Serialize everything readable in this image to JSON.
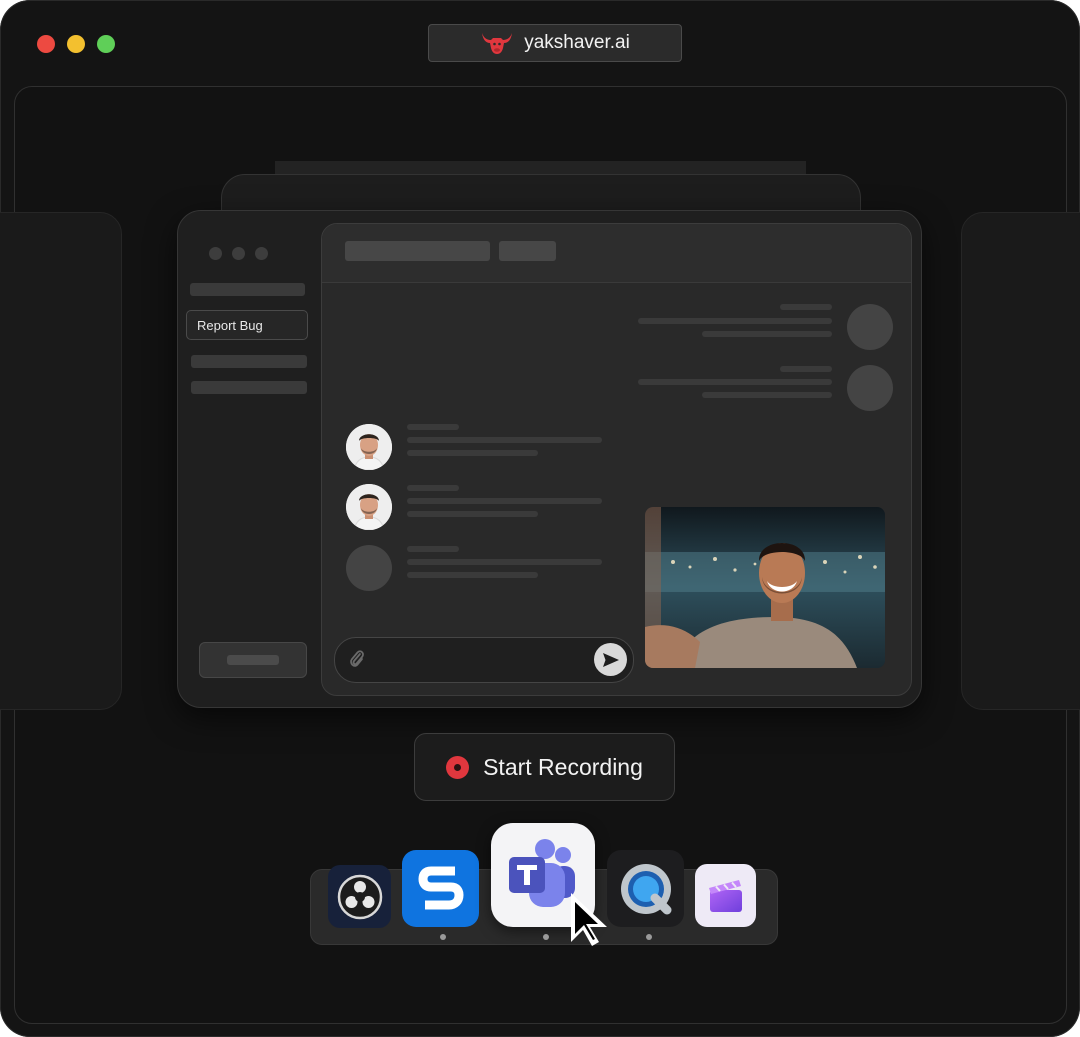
{
  "window": {
    "traffic_lights": [
      "close",
      "minimize",
      "zoom"
    ],
    "colors": {
      "close": "#ed4a41",
      "minimize": "#f3c02f",
      "zoom": "#5fcf58"
    }
  },
  "url_bar": {
    "icon": "bull-logo-icon",
    "text": "yakshaver.ai",
    "icon_color": "#e0373e"
  },
  "app_window": {
    "sidebar": {
      "items": [
        {
          "label": ""
        },
        {
          "label": "Report Bug",
          "selected": true
        },
        {
          "label": ""
        },
        {
          "label": ""
        }
      ],
      "footer_button": {
        "label": ""
      }
    },
    "chat": {
      "header": {
        "title": "",
        "tab": ""
      },
      "messages": [
        {
          "side": "right",
          "avatar": "placeholder"
        },
        {
          "side": "right",
          "avatar": "placeholder"
        },
        {
          "side": "left",
          "avatar": "photo"
        },
        {
          "side": "left",
          "avatar": "photo"
        },
        {
          "side": "left",
          "avatar": "placeholder"
        }
      ],
      "composer": {
        "attach_icon": "paperclip-icon",
        "send_icon": "send-icon",
        "placeholder": ""
      }
    },
    "video_preview": {
      "description_icon": "webcam-feed"
    }
  },
  "record_button": {
    "label": "Start Recording",
    "icon": "record-dot-icon",
    "icon_color": "#e0373e"
  },
  "dock": {
    "apps": [
      {
        "name": "obs-studio-icon",
        "running": false
      },
      {
        "name": "snagit-icon",
        "running": true
      },
      {
        "name": "microsoft-teams-icon",
        "running": true,
        "hovered": true
      },
      {
        "name": "quicktime-icon",
        "running": true
      },
      {
        "name": "clipchamp-icon",
        "running": false
      }
    ]
  }
}
